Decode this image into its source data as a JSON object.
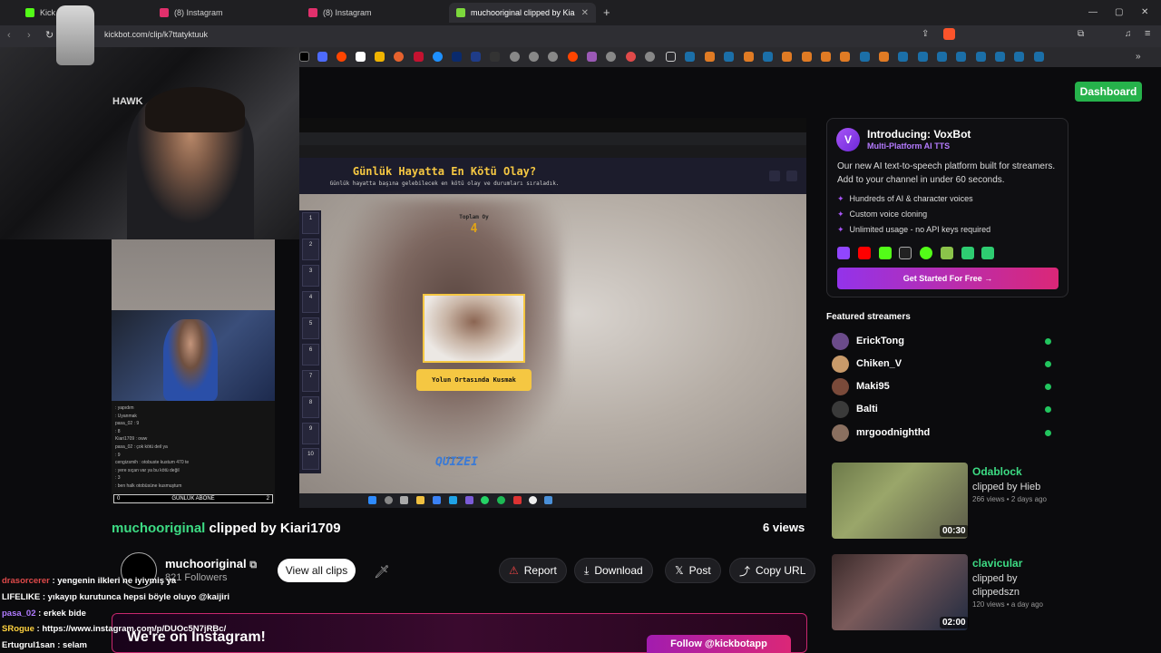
{
  "browser": {
    "tabs": [
      {
        "label": "Kick Chat Tak"
      },
      {
        "label": "(8) Instagram"
      },
      {
        "label": "(8) Instagram"
      },
      {
        "label": "muchooriginal clipped by Kia"
      }
    ],
    "url": "kickbot.com/clip/k7ttatyktuuk"
  },
  "webcam": {
    "chair_logo": "HAWK"
  },
  "mini_chat": {
    "lines": [
      ": yapıdım",
      ": Uyanmak",
      "pasa_02 : 9",
      ": 8",
      "Kiari1709 : oww",
      "pasa_02 : çok kötü deil ya",
      ": 9",
      "cengizsmih : otobuste kustum 470 te",
      ": yere sıçan var ya bu kötü değil",
      ": 3",
      ": ben halk otobüsüne kusmuştum"
    ],
    "score_left": "0",
    "score_label": "GÜNLÜK ABONE",
    "score_right": "2"
  },
  "game": {
    "title": "Günlük Hayatta En Kötü Olay?",
    "subtitle": "Günlük hayatta başına gelebilecek en kötü olay ve durumları sıraladık.",
    "total_label": "Toplam Oy",
    "total_value": "4",
    "slots": [
      "1",
      "2",
      "3",
      "4",
      "5",
      "6",
      "7",
      "8",
      "9",
      "10"
    ],
    "answer": "Yolun Ortasında Kusmak",
    "made_with": "made with",
    "brand": "QUIZEI"
  },
  "dashboard_label": "Dashboard",
  "promo": {
    "logo": "V",
    "title": "Introducing: VoxBot",
    "subtitle": "Multi-Platform AI TTS",
    "description": "Our new AI text-to-speech platform built for streamers. Add to your channel in under 60 seconds.",
    "features": [
      "Hundreds of AI & character voices",
      "Custom voice cloning",
      "Unlimited usage - no API keys required"
    ],
    "cta": "Get Started For Free →"
  },
  "featured": {
    "heading": "Featured streamers",
    "streamers": [
      "ErickTong",
      "Chiken_V",
      "Maki95",
      "Balti",
      "mrgoodnighthd"
    ]
  },
  "related_clips": [
    {
      "title": "Odablock",
      "by": "clipped by Hieb",
      "meta": "266 views • 2 days ago",
      "duration": "00:30"
    },
    {
      "title": "clavicular",
      "by": "clipped by clippedszn",
      "meta": "120 views • a day ago",
      "duration": "02:00"
    }
  ],
  "clip": {
    "channel": "muchooriginal",
    "clipped_by": " clipped by Kiari1709",
    "views": "6 views",
    "channel_name": "muchooriginal",
    "followers": "821 Followers",
    "view_all": "View all clips",
    "actions": {
      "report": "Report",
      "download": "Download",
      "post": "Post",
      "copy": "Copy URL"
    }
  },
  "stream_chat": [
    {
      "user": "drasorcerer",
      "msg": " : yengenin ilkleri ne iyiymiş ya",
      "color": "#e04a4a"
    },
    {
      "user": "LIFELIKE",
      "msg": " : yıkayıp kurutunca hepsi böyle oluyo @kaijiri",
      "color": "#ffffff"
    },
    {
      "user": "pasa_02",
      "msg": " : erkek bide",
      "color": "#b07bff"
    },
    {
      "user": "SRogue",
      "msg": " : https://www.instagram.com/p/DUOc5N7jRBc/",
      "color": "#ffd23f"
    },
    {
      "user": "Ertugrul1san",
      "msg": " : selam",
      "color": "#ffffff"
    }
  ],
  "instagram": {
    "text": "We're on Instagram!",
    "button": "Follow @kickbotapp"
  }
}
